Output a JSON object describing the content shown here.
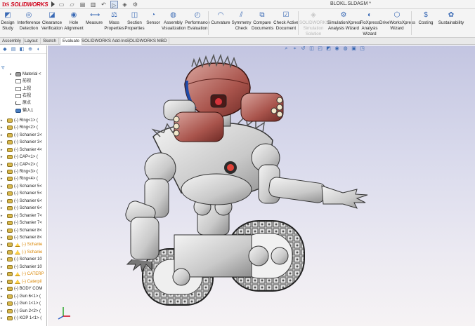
{
  "app": {
    "logo_ds": "DS",
    "logo_name": "SOLIDWORKS",
    "document_title": "BLOKL.SLDASM *"
  },
  "quick_access": [
    "select",
    "rebuild",
    "options"
  ],
  "ribbon": {
    "buttons": [
      {
        "label_1": "Design",
        "label_2": "Study",
        "icon": "design-study-icon"
      },
      {
        "label_1": "Interference",
        "label_2": "Detection",
        "icon": "interference-icon"
      },
      {
        "label_1": "Clearance",
        "label_2": "Verification",
        "icon": "clearance-icon"
      },
      {
        "label_1": "Hole",
        "label_2": "Alignment",
        "icon": "hole-icon"
      },
      {
        "label_1": "Measure",
        "label_2": "",
        "icon": "measure-icon"
      },
      {
        "label_1": "Mass",
        "label_2": "Properties",
        "icon": "mass-icon"
      },
      {
        "label_1": "Section",
        "label_2": "Properties",
        "icon": "section-icon"
      },
      {
        "label_1": "Sensor",
        "label_2": "",
        "icon": "sensor-icon"
      },
      {
        "label_1": "Assembly",
        "label_2": "Visualization",
        "icon": "assembly-vis-icon"
      },
      {
        "label_1": "Performance",
        "label_2": "Evaluation",
        "icon": "performance-icon"
      },
      {
        "label_1": "Curvature",
        "label_2": "",
        "icon": "curvature-icon"
      },
      {
        "label_1": "Symmetry",
        "label_2": "Check",
        "icon": "symmetry-icon"
      },
      {
        "label_1": "Compare",
        "label_2": "Documents",
        "icon": "compare-icon"
      },
      {
        "label_1": "Check Active",
        "label_2": "Document",
        "icon": "check-doc-icon"
      },
      {
        "label_1": "SOLIDWORKS Simulation",
        "label_2": "Solution",
        "icon": "simulation-icon"
      },
      {
        "label_1": "SimulationXpress",
        "label_2": "Analysis Wizard",
        "icon": "simxpress-icon"
      },
      {
        "label_1": "FloXpress",
        "label_2": "Analysis",
        "label_3": "Wizard",
        "icon": "floxpress-icon"
      },
      {
        "label_1": "DriveWorksXpress",
        "label_2": "Wizard",
        "icon": "driveworks-icon"
      },
      {
        "label_1": "Costing",
        "label_2": "",
        "icon": "costing-icon"
      },
      {
        "label_1": "Sustainability",
        "label_2": "",
        "icon": "sustainability-icon"
      }
    ]
  },
  "tabs": [
    "Assembly",
    "Layout",
    "Sketch",
    "Evaluate",
    "SOLIDWORKS Add-Ins",
    "SOLIDWORKS MBD"
  ],
  "active_tab": "Evaluate",
  "tree": {
    "header_items": [
      {
        "label": "Material <",
        "type": "material"
      },
      {
        "label": "前视",
        "type": "plane"
      },
      {
        "label": "上视",
        "type": "plane"
      },
      {
        "label": "右视",
        "type": "plane"
      },
      {
        "label": "原点",
        "type": "origin"
      },
      {
        "label": "输入1",
        "type": "import"
      }
    ],
    "components": [
      {
        "label": "(-) Ring<1> (",
        "state": "normal"
      },
      {
        "label": "(-) Ring<2> (",
        "state": "normal"
      },
      {
        "label": "(-) Schanier 2<",
        "state": "normal"
      },
      {
        "label": "(-) Schanier 3<",
        "state": "normal"
      },
      {
        "label": "(-) Schanier 4<",
        "state": "normal"
      },
      {
        "label": "(-) CAP<1> (",
        "state": "normal"
      },
      {
        "label": "(-) CAP<2> (",
        "state": "normal"
      },
      {
        "label": "(-) Ring<3> (",
        "state": "normal"
      },
      {
        "label": "(-) Ring<4> (",
        "state": "normal"
      },
      {
        "label": "(-) Schanier 5<",
        "state": "normal"
      },
      {
        "label": "(-) Schanier 5<",
        "state": "normal"
      },
      {
        "label": "(-) Schanier 6<",
        "state": "normal"
      },
      {
        "label": "(-) Schanier 6<",
        "state": "normal"
      },
      {
        "label": "(-) Schanier 7<",
        "state": "normal"
      },
      {
        "label": "(-) Schanier 7<",
        "state": "normal"
      },
      {
        "label": "(-) Schanier 8<",
        "state": "normal"
      },
      {
        "label": "(-) Schanier 8<",
        "state": "normal"
      },
      {
        "label": "(-) Schanie",
        "state": "warning"
      },
      {
        "label": "(-) Schanie",
        "state": "warning"
      },
      {
        "label": "(-) Schanier 10",
        "state": "normal"
      },
      {
        "label": "(-) Schanier 10",
        "state": "normal"
      },
      {
        "label": "(-) CATERP",
        "state": "warning"
      },
      {
        "label": "(-) Caterpil",
        "state": "warning"
      },
      {
        "label": "(-) BODY COM",
        "state": "normal"
      },
      {
        "label": "(-) Gun 6<1> (",
        "state": "normal"
      },
      {
        "label": "(-) Gun 1<1> (",
        "state": "normal"
      },
      {
        "label": "(-) Gun 2<2> (",
        "state": "normal"
      },
      {
        "label": "(-) KOP 1<1> (",
        "state": "normal"
      }
    ]
  },
  "colors": {
    "accent": "#d0021b",
    "viewport_top": "#c3c5e1",
    "viewport_bottom": "#f6f3f4",
    "warning": "#d88500"
  }
}
